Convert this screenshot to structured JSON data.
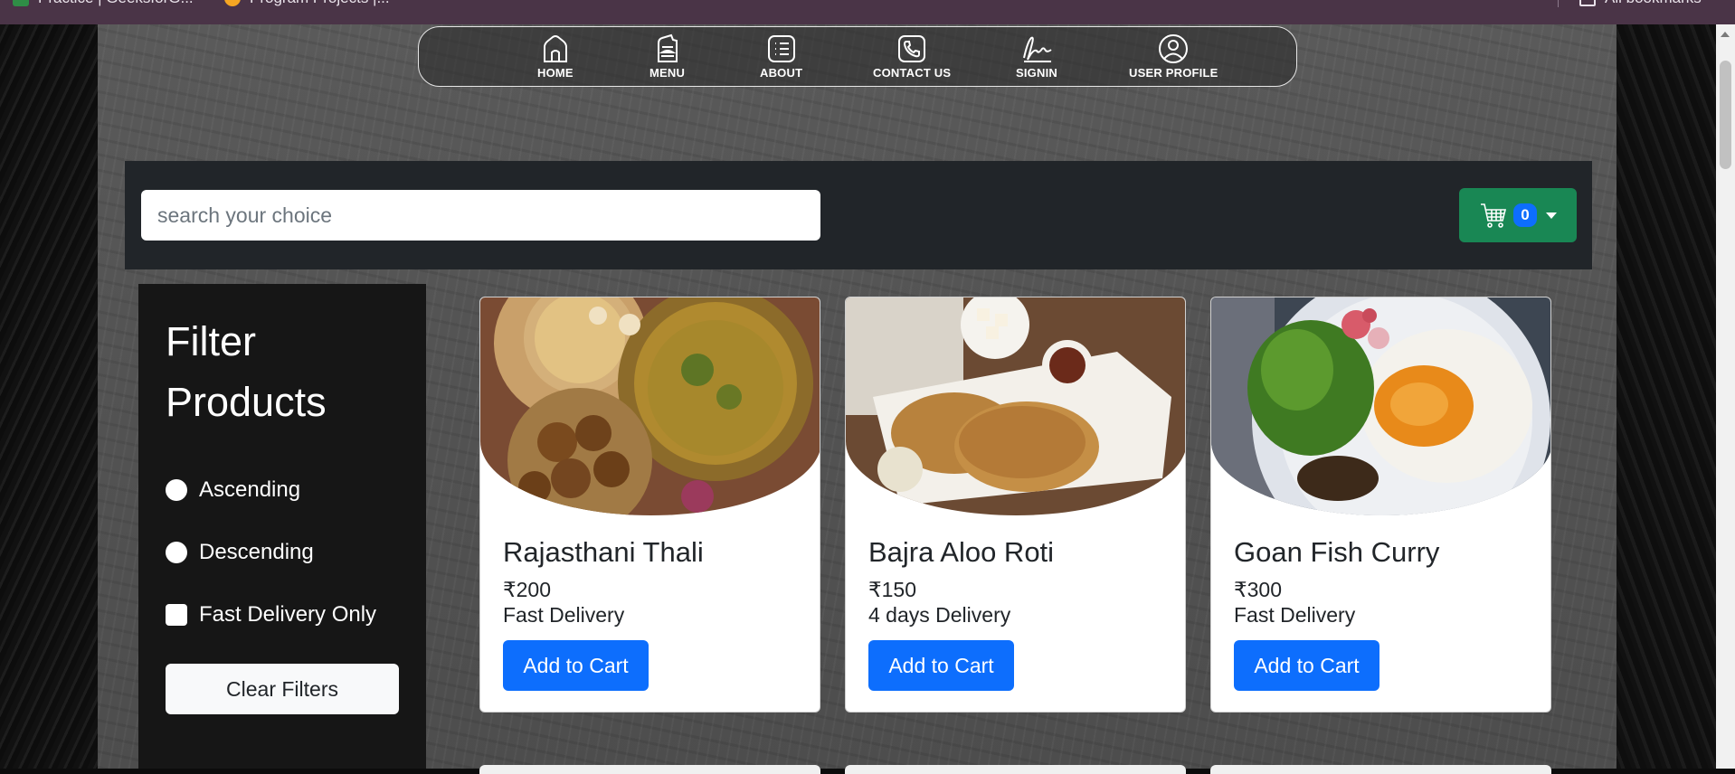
{
  "browser": {
    "bookmarks": [
      {
        "label": "Practice | GeeksforG..."
      },
      {
        "label": "Program Projects |..."
      },
      {
        "label": "All bookmarks"
      }
    ]
  },
  "nav": {
    "items": [
      {
        "label": "HOME",
        "icon": "home-icon"
      },
      {
        "label": "MENU",
        "icon": "menu-icon"
      },
      {
        "label": "ABOUT",
        "icon": "about-icon"
      },
      {
        "label": "CONTACT US",
        "icon": "phone-icon"
      },
      {
        "label": "SIGNIN",
        "icon": "signature-icon"
      },
      {
        "label": "USER PROFILE",
        "icon": "user-icon"
      }
    ]
  },
  "search": {
    "placeholder": "search your choice",
    "value": ""
  },
  "cart": {
    "count": "0",
    "icon": "cart-icon",
    "color": "#198754",
    "badge_color": "#0d6efd"
  },
  "filter": {
    "title": "Filter Products",
    "options": [
      {
        "label": "Ascending",
        "type": "radio"
      },
      {
        "label": "Descending",
        "type": "radio"
      },
      {
        "label": "Fast Delivery Only",
        "type": "checkbox"
      }
    ],
    "clear_label": "Clear Filters"
  },
  "products": [
    {
      "name": "Rajasthani Thali",
      "price": "₹200",
      "delivery": "Fast Delivery",
      "button": "Add to Cart"
    },
    {
      "name": "Bajra Aloo Roti",
      "price": "₹150",
      "delivery": "4 days Delivery",
      "button": "Add to Cart"
    },
    {
      "name": "Goan Fish Curry",
      "price": "₹300",
      "delivery": "Fast Delivery",
      "button": "Add to Cart"
    }
  ],
  "colors": {
    "primary_button": "#0d6efd",
    "search_band": "#212529",
    "filter_panel": "#161616"
  }
}
